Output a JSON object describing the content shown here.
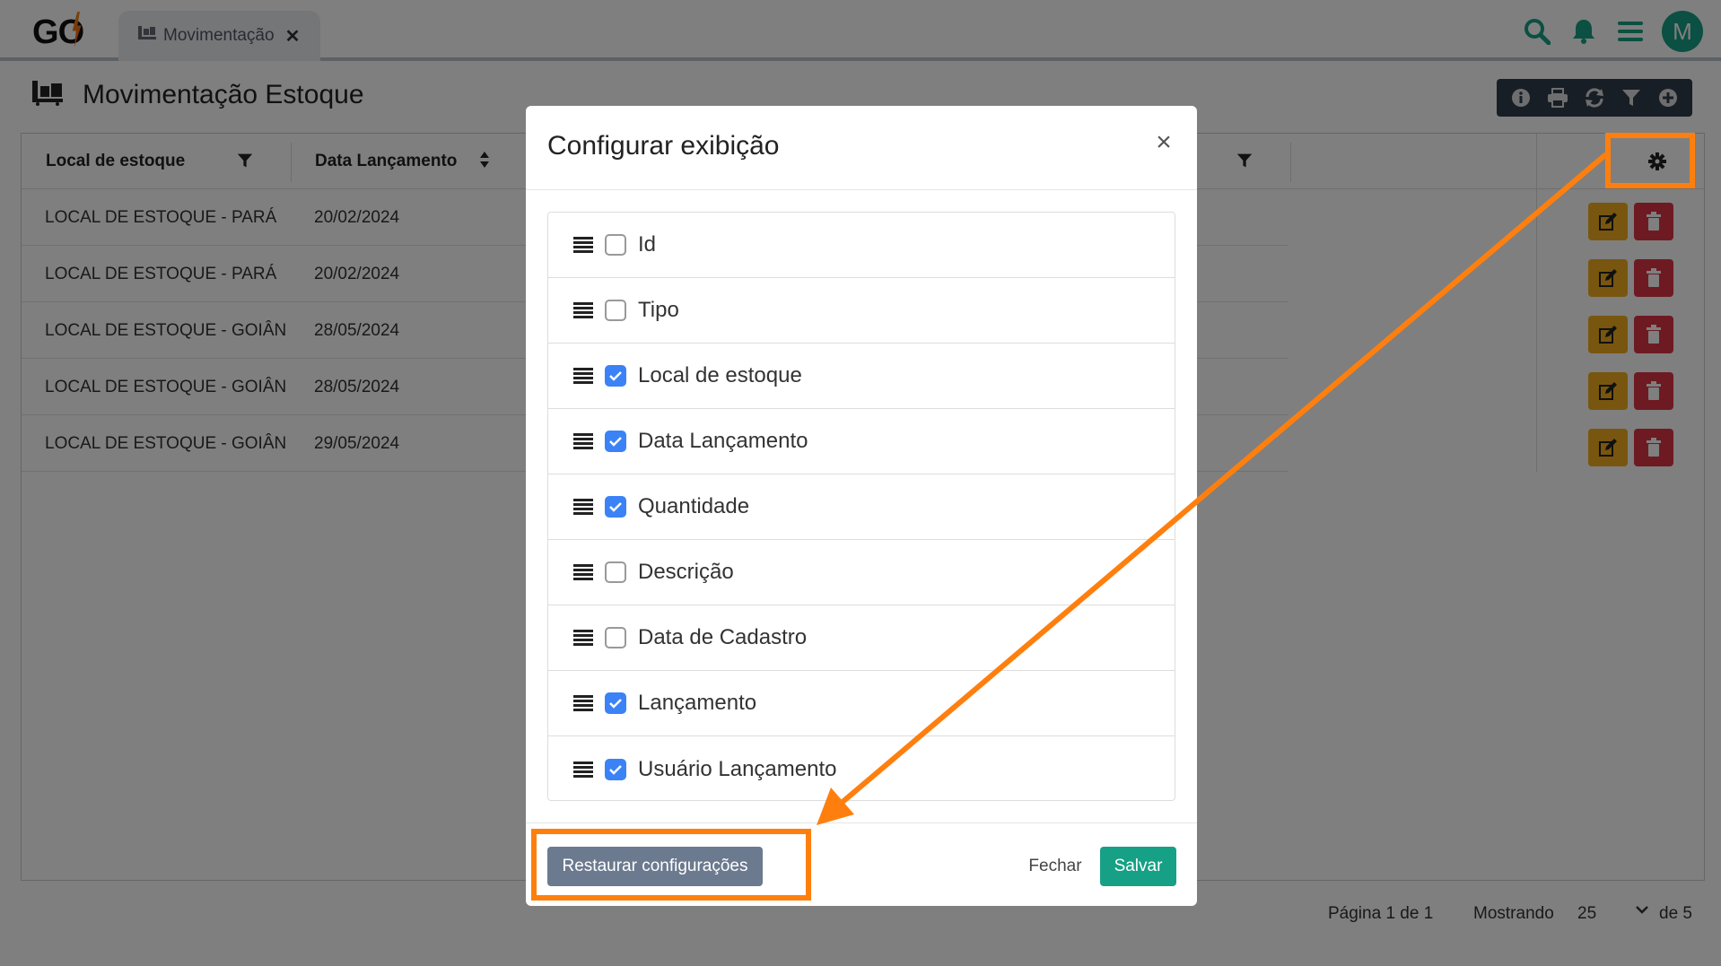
{
  "topbar": {
    "logo": "GO",
    "tab_label": "Movimentação",
    "tab_close": "✕",
    "avatar_initial": "M",
    "icons": [
      "search-icon",
      "bell-icon",
      "menu-icon"
    ]
  },
  "page": {
    "title": "Movimentação Estoque",
    "toolbar_icons": [
      "info-icon",
      "print-icon",
      "refresh-icon",
      "filter-icon",
      "add-icon"
    ]
  },
  "table": {
    "headers": {
      "local": "Local de estoque",
      "data": "Data Lançamento"
    },
    "rows": [
      {
        "local": "LOCAL DE ESTOQUE - PARÁ",
        "data": "20/02/2024"
      },
      {
        "local": "LOCAL DE ESTOQUE - PARÁ",
        "data": "20/02/2024"
      },
      {
        "local": "LOCAL DE ESTOQUE - GOIÂN",
        "data": "28/05/2024"
      },
      {
        "local": "LOCAL DE ESTOQUE - GOIÂN",
        "data": "28/05/2024"
      },
      {
        "local": "LOCAL DE ESTOQUE - GOIÂN",
        "data": "29/05/2024"
      }
    ]
  },
  "pagination": {
    "page_info": "Página 1 de 1",
    "showing_label": "Mostrando",
    "page_size": "25",
    "total": "de 5"
  },
  "modal": {
    "title": "Configurar exibição",
    "close": "×",
    "columns": [
      {
        "label": "Id",
        "checked": false
      },
      {
        "label": "Tipo",
        "checked": false
      },
      {
        "label": "Local de estoque",
        "checked": true
      },
      {
        "label": "Data Lançamento",
        "checked": true
      },
      {
        "label": "Quantidade",
        "checked": true
      },
      {
        "label": "Descrição",
        "checked": false
      },
      {
        "label": "Data de Cadastro",
        "checked": false
      },
      {
        "label": "Lançamento",
        "checked": true
      },
      {
        "label": "Usuário Lançamento",
        "checked": true
      }
    ],
    "restore_label": "Restaurar configurações",
    "close_label": "Fechar",
    "save_label": "Salvar"
  },
  "colors": {
    "accent": "#16a085",
    "annotation": "#ff7f0e",
    "edit": "#f0ad1e",
    "delete": "#dc3545",
    "checkbox_on": "#3b82f6"
  }
}
